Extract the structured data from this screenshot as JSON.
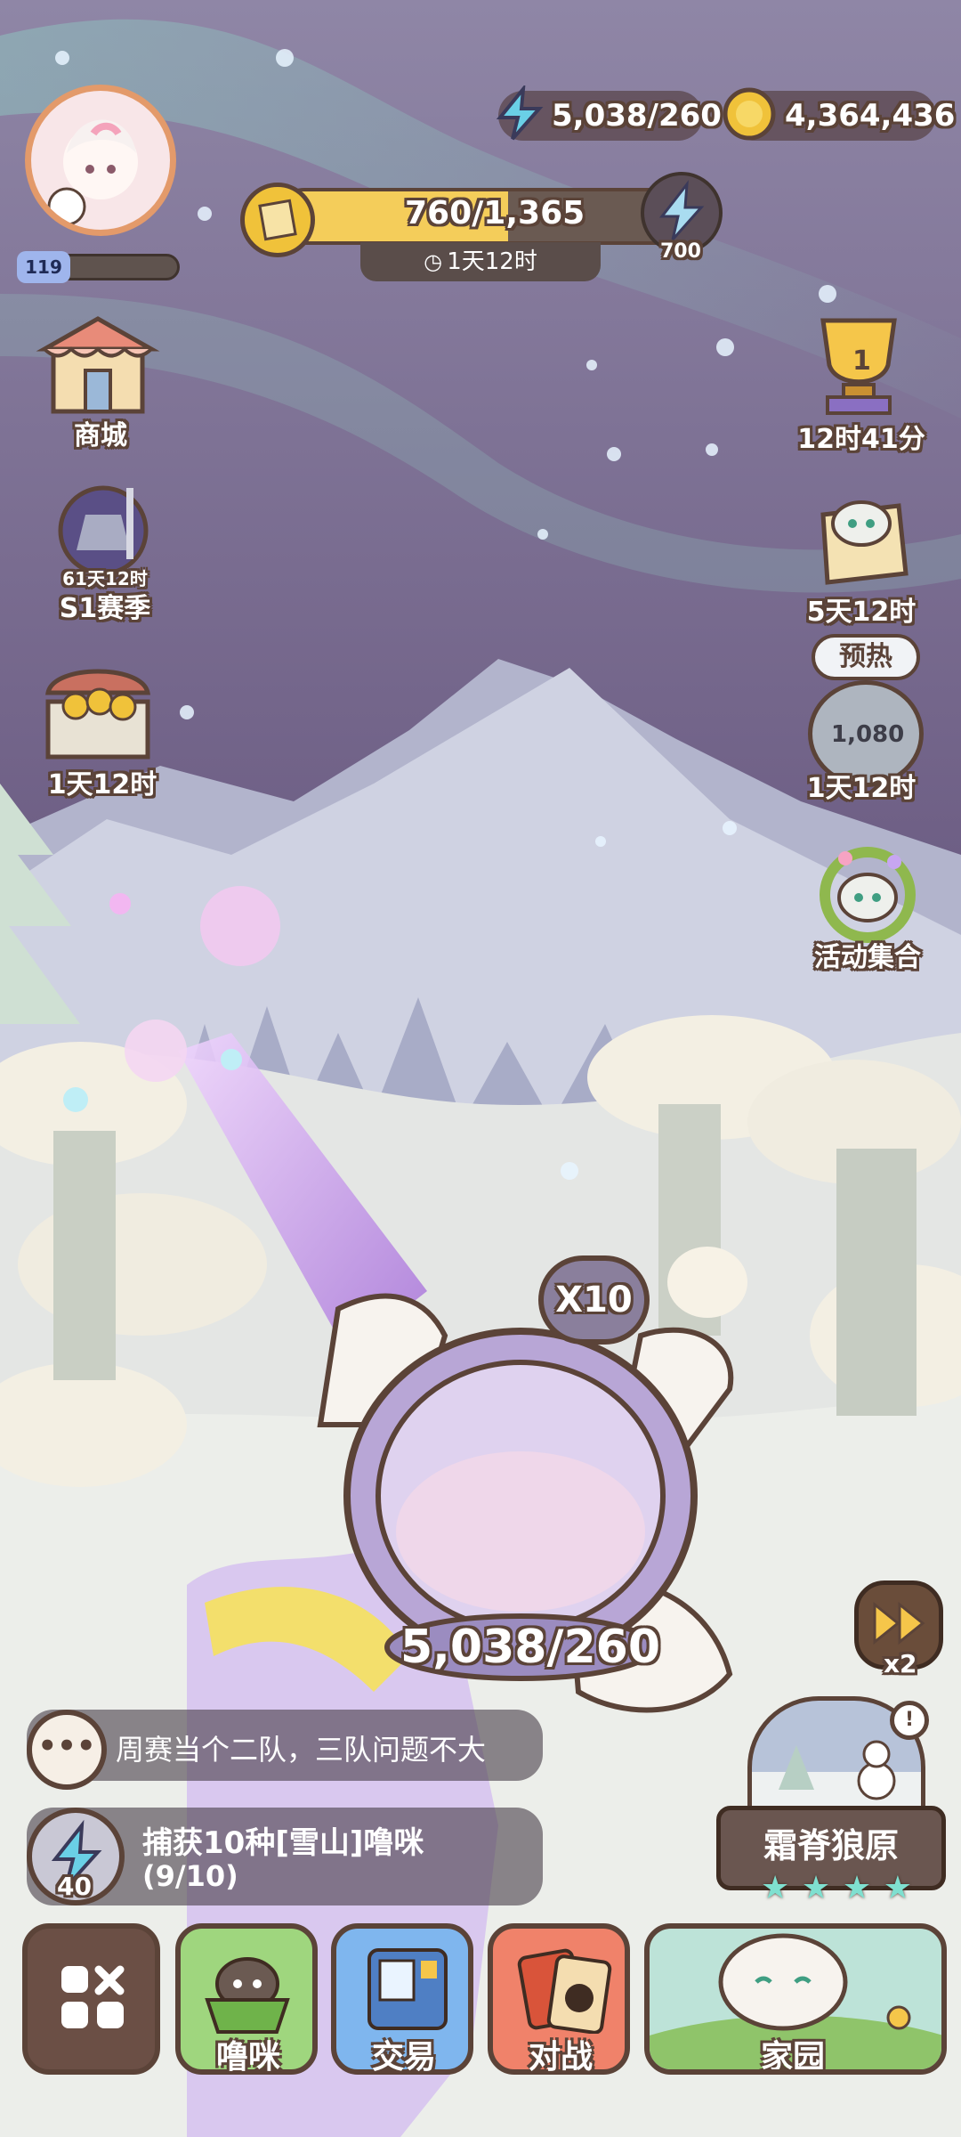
{
  "resources": {
    "energy": "5,038/260",
    "coins": "4,364,436"
  },
  "player": {
    "level": "119"
  },
  "season_bar": {
    "progress": "760/1,365",
    "progress_fraction": 0.557,
    "timer": "1天12时",
    "bonus": "700"
  },
  "left_menu": {
    "shop": "商城",
    "season_timer": "61天12时",
    "season": "S1赛季",
    "chest_timer": "1天12时"
  },
  "right_menu": {
    "trophy_rank": "1",
    "trophy_timer": "12时41分",
    "scroll_timer": "5天12时",
    "warmup_badge": "预热",
    "medal_value": "1,080",
    "medal_timer": "1天12时",
    "events": "活动集合"
  },
  "catcher": {
    "multiplier": "X10",
    "energy": "5,038/260"
  },
  "speed": {
    "label": "x2"
  },
  "chat": {
    "message": "周赛当个二队，三队问题不大"
  },
  "quest": {
    "cost": "40",
    "title": "捕获10种[雪山]噜咪",
    "progress": "(9/10)"
  },
  "location": {
    "name": "霜脊狼原",
    "stars": [
      "★",
      "★",
      "★",
      "★"
    ]
  },
  "nav": {
    "pets": "噜咪",
    "trade": "交易",
    "battle": "对战",
    "home": "家园"
  },
  "colors": {
    "outline": "#5b4338",
    "sky_top": "#8f86a6",
    "sky_bottom": "#6e5f85",
    "energy": "#6ad0e6",
    "coin": "#f0c23a"
  }
}
